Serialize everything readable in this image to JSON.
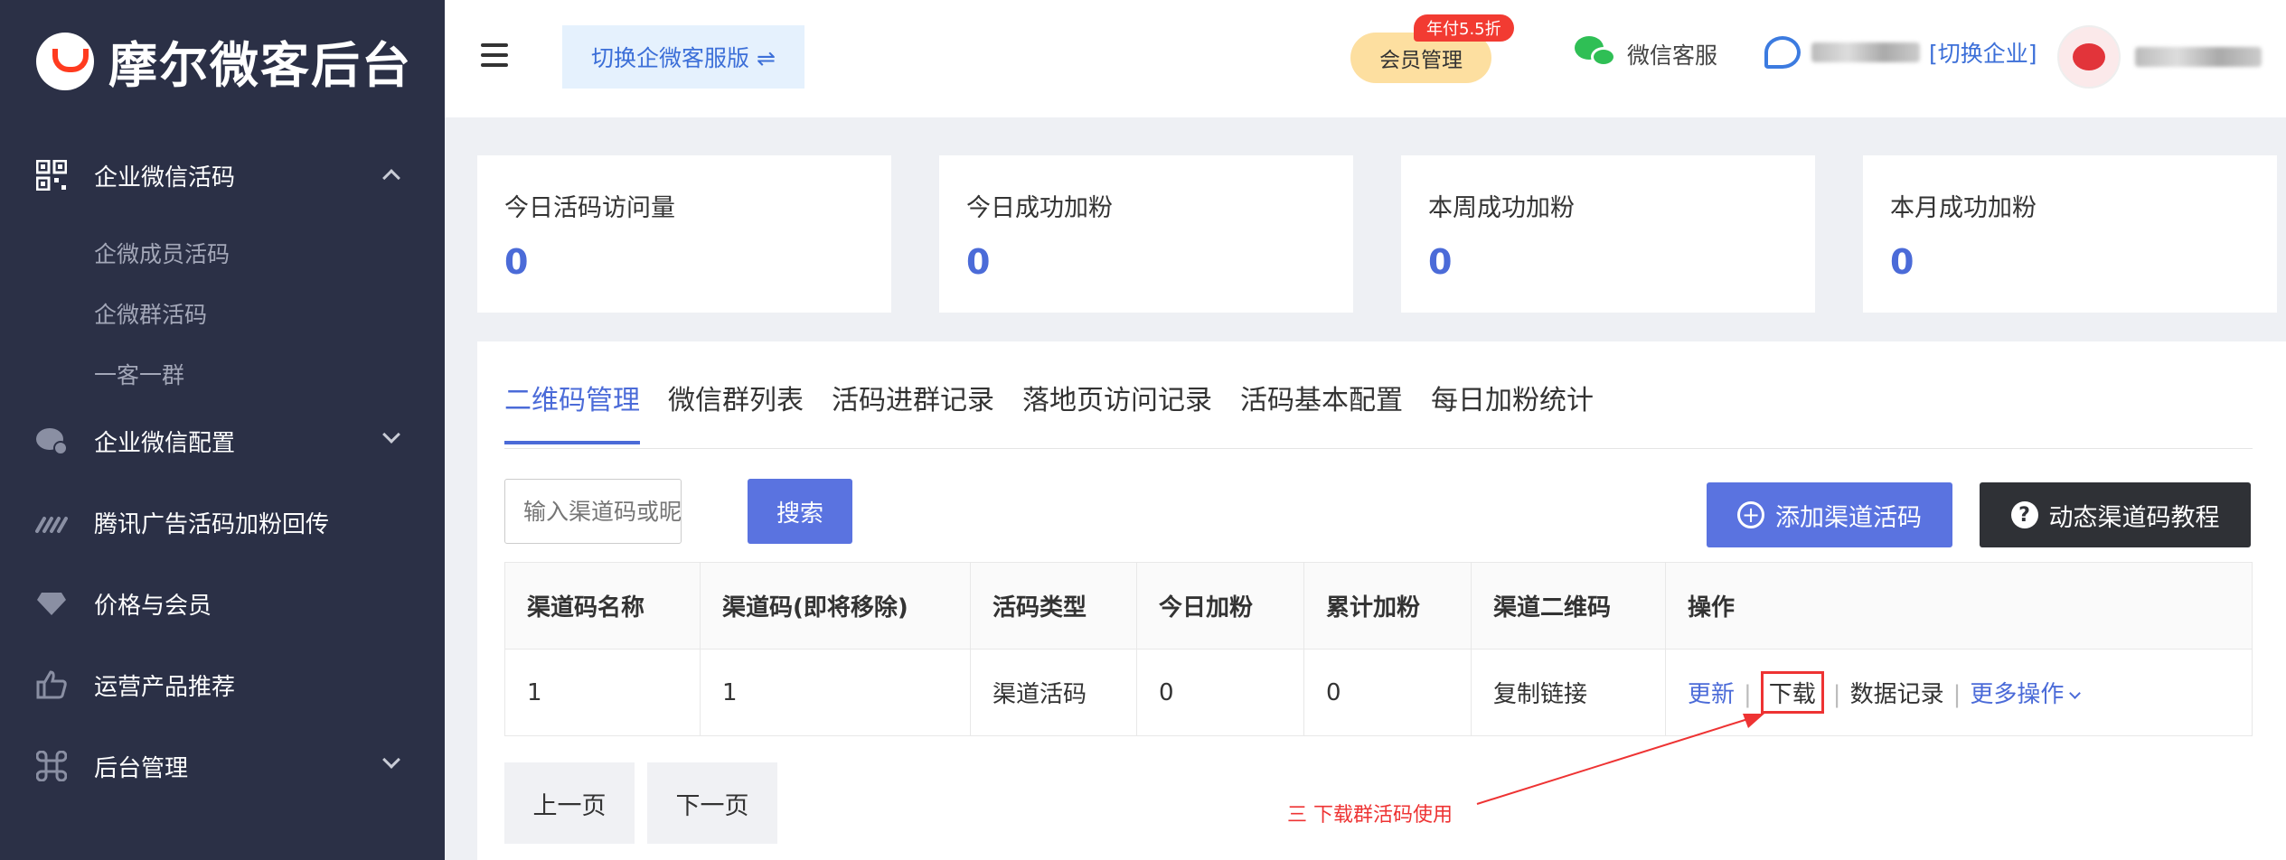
{
  "sidebar": {
    "logo_text": "摩尔微客后台",
    "menu": [
      {
        "label": "企业微信活码",
        "icon": "qrcode-icon",
        "expanded": true,
        "children": [
          "企微成员活码",
          "企微群活码",
          "一客一群"
        ]
      },
      {
        "label": "企业微信配置",
        "icon": "chat-bubble-icon",
        "expanded": false
      },
      {
        "label": "腾讯广告活码加粉回传",
        "icon": "signal-icon"
      },
      {
        "label": "价格与会员",
        "icon": "diamond-icon"
      },
      {
        "label": "运营产品推荐",
        "icon": "thumbs-up-icon"
      },
      {
        "label": "后台管理",
        "icon": "command-icon",
        "expanded": false
      }
    ]
  },
  "header": {
    "switch_label": "切换企微客服版 ⇌",
    "vip_label": "会员管理",
    "vip_badge": "年付5.5折",
    "service_label": "微信客服",
    "company_suffix": "[切换企业]"
  },
  "stats": [
    {
      "title": "今日活码访问量",
      "value": "0"
    },
    {
      "title": "今日成功加粉",
      "value": "0"
    },
    {
      "title": "本周成功加粉",
      "value": "0"
    },
    {
      "title": "本月成功加粉",
      "value": "0"
    }
  ],
  "tabs": [
    "二维码管理",
    "微信群列表",
    "活码进群记录",
    "落地页访问记录",
    "活码基本配置",
    "每日加粉统计"
  ],
  "toolbar": {
    "search_placeholder": "输入渠道码或昵",
    "search_label": "搜索",
    "add_label": "添加渠道活码",
    "tutorial_label": "动态渠道码教程"
  },
  "table": {
    "headers": [
      "渠道码名称",
      "渠道码(即将移除)",
      "活码类型",
      "今日加粉",
      "累计加粉",
      "渠道二维码",
      "操作"
    ],
    "rows": [
      {
        "name": "1",
        "code": "1",
        "type": "渠道活码",
        "today": "0",
        "total": "0",
        "qr": "复制链接"
      }
    ],
    "ops": {
      "update": "更新",
      "download": "下载",
      "records": "数据记录",
      "more": "更多操作"
    }
  },
  "pagination": {
    "prev": "上一页",
    "next": "下一页"
  },
  "annotation": "三 下载群活码使用"
}
